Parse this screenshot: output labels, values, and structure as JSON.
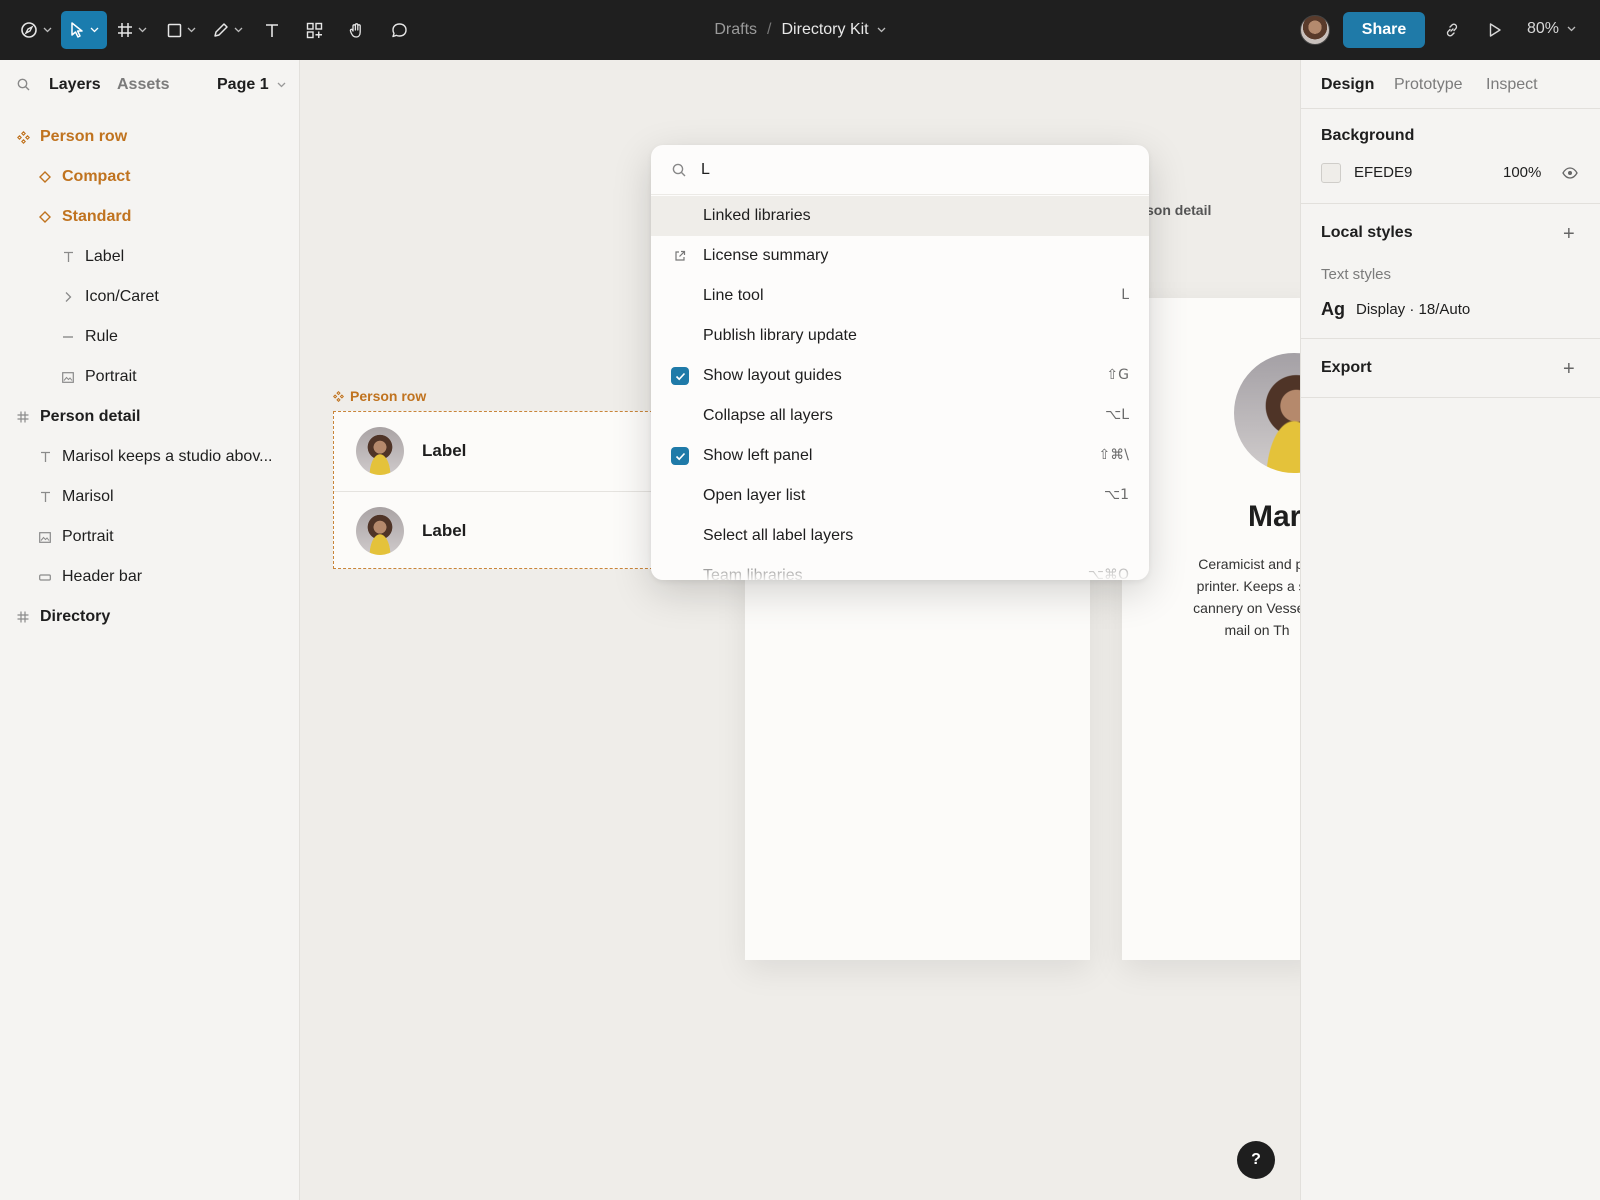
{
  "toolbar": {
    "breadcrumb_parent": "Drafts",
    "breadcrumb_sep": "/",
    "document_name": "Directory Kit",
    "share_label": "Share",
    "zoom_label": "80%"
  },
  "left_panel": {
    "tabs": {
      "layers": "Layers",
      "assets": "Assets"
    },
    "page_label": "Page 1",
    "layers": [
      {
        "label": "Person row",
        "icon": "component-set-icon",
        "kind": "comp"
      },
      {
        "label": "Compact",
        "icon": "variant-icon",
        "kind": "comp"
      },
      {
        "label": "Standard",
        "icon": "variant-icon",
        "kind": "comp"
      },
      {
        "label": "Label",
        "icon": "text-icon",
        "kind": "normal"
      },
      {
        "label": "Icon/Caret",
        "icon": "caret-icon",
        "kind": "normal"
      },
      {
        "label": "Rule",
        "icon": "line-icon",
        "kind": "normal"
      },
      {
        "label": "Portrait",
        "icon": "image-icon",
        "kind": "normal"
      },
      {
        "label": "Person detail",
        "icon": "frame-icon",
        "kind": "frame"
      },
      {
        "label": "Marisol keeps a studio abov...",
        "icon": "text-icon",
        "kind": "normal"
      },
      {
        "label": "Marisol",
        "icon": "text-icon",
        "kind": "normal"
      },
      {
        "label": "Portrait",
        "icon": "image-icon",
        "kind": "normal"
      },
      {
        "label": "Header bar",
        "icon": "rectangle-icon",
        "kind": "normal"
      },
      {
        "label": "Directory",
        "icon": "frame-icon",
        "kind": "frame"
      }
    ]
  },
  "canvas": {
    "person_row_label": "Person row",
    "person_detail_label": "son detail",
    "rows": [
      {
        "label": "Label"
      },
      {
        "label": "Label"
      }
    ],
    "detail_name": "Mar",
    "detail_bio_lines": [
      "Ceramicist and par",
      "printer. Keeps a stu",
      "cannery on Vessel S",
      "mail on Th"
    ],
    "help_label": "?"
  },
  "command_palette": {
    "query": "L",
    "items": [
      {
        "label": "Linked libraries",
        "shortcut": "",
        "lead": "",
        "highlighted": true
      },
      {
        "label": "License summary",
        "shortcut": "",
        "lead": "external-link-icon",
        "highlighted": false
      },
      {
        "label": "Line tool",
        "shortcut": "L",
        "lead": "",
        "highlighted": false
      },
      {
        "label": "Publish library update",
        "shortcut": "",
        "lead": "",
        "highlighted": false
      },
      {
        "label": "Show layout guides",
        "shortcut": "⇧G",
        "lead": "checkbox-checked",
        "highlighted": false
      },
      {
        "label": "Collapse all layers",
        "shortcut": "⌥L",
        "lead": "",
        "highlighted": false
      },
      {
        "label": "Show left panel",
        "shortcut": "⇧⌘\\",
        "lead": "checkbox-checked",
        "highlighted": false
      },
      {
        "label": "Open layer list",
        "shortcut": "⌥1",
        "lead": "",
        "highlighted": false
      },
      {
        "label": "Select all label layers",
        "shortcut": "",
        "lead": "",
        "highlighted": false
      },
      {
        "label": "Team libraries",
        "shortcut": "⌥⌘O",
        "lead": "",
        "highlighted": false
      }
    ]
  },
  "right_panel": {
    "tabs": {
      "design": "Design",
      "prototype": "Prototype",
      "inspect": "Inspect"
    },
    "background": {
      "title": "Background",
      "hex": "EFEDE9",
      "opacity": "100%"
    },
    "local_styles": {
      "title": "Local styles",
      "subheading": "Text styles",
      "sample": "Ag",
      "style_name": "Display · 18/Auto"
    },
    "export": {
      "title": "Export"
    }
  },
  "colors": {
    "accent": "#1f7aa8",
    "component": "#c0731f",
    "canvas_bg": "#efede9",
    "toolbar_bg": "#1f1f1f"
  }
}
